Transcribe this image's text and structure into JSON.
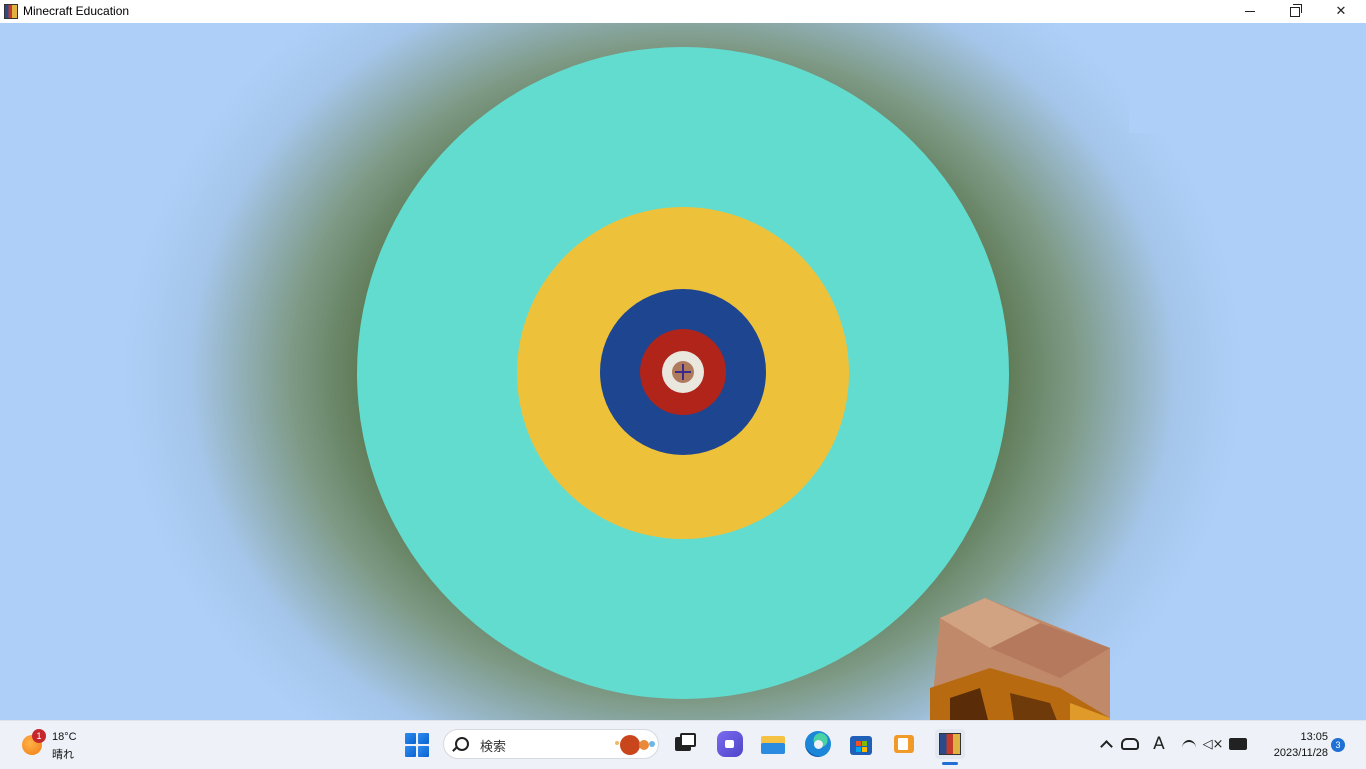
{
  "window": {
    "title": "Minecraft Education",
    "icon": "minecraft-education-icon",
    "controls": [
      "minimize-icon",
      "restore-icon",
      "close-icon"
    ]
  },
  "scene": {
    "description_colors": {
      "outer_ring": "#62dccf",
      "yellow_ring": "#eec13a",
      "blue_ring": "#1e4590",
      "red_ring": "#b0241a",
      "white_ring": "#e9e7de",
      "center": "#b07a5c",
      "sky": "#aecff8",
      "ground_shadow": "#55704a"
    }
  },
  "taskbar": {
    "weather": {
      "badge": "1",
      "temp": "18°C",
      "condition": "晴れ"
    },
    "search": {
      "placeholder": "検索"
    },
    "apps": [
      "start-icon",
      "task-view-icon",
      "chat-icon",
      "file-explorer-icon",
      "edge-icon",
      "store-icon",
      "media-player-icon",
      "minecraft-education-icon"
    ],
    "tray": {
      "ime": "A",
      "volume": "◁×"
    },
    "clock": {
      "time": "13:05",
      "date": "2023/11/28"
    },
    "notifications": "3",
    "accent": "#1f6fd6"
  }
}
